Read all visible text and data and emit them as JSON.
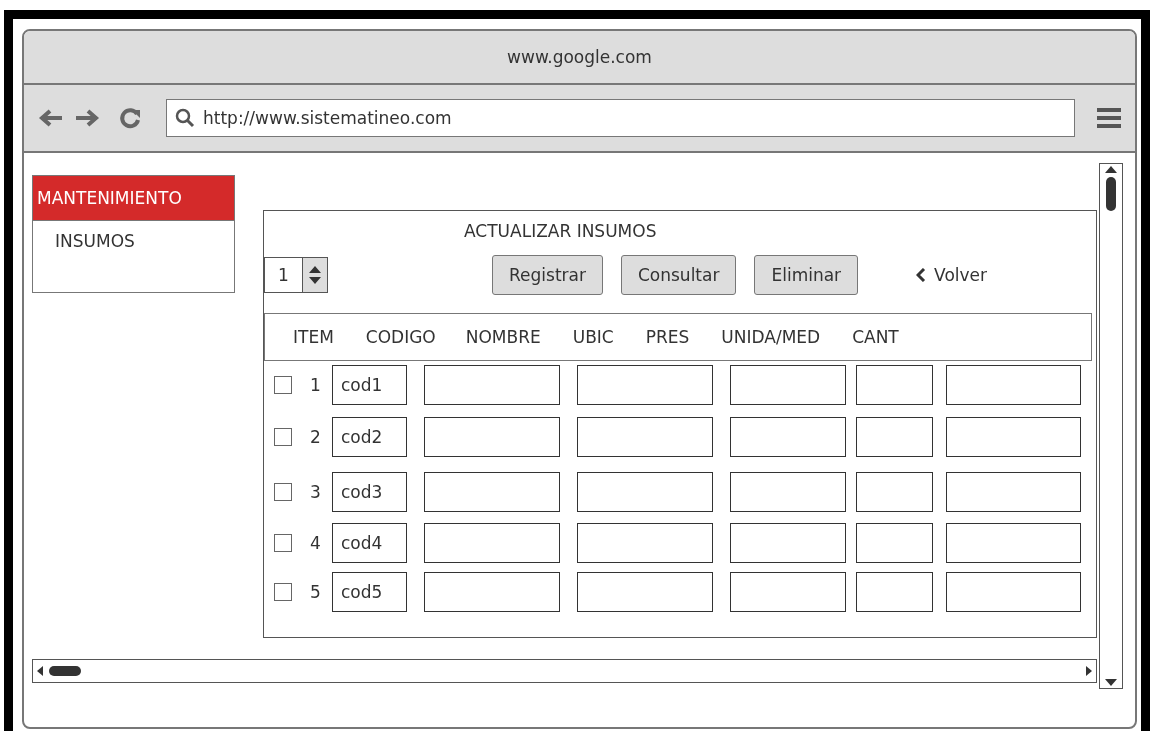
{
  "window": {
    "title": "www.google.com"
  },
  "toolbar": {
    "url": "http://www.sistematineo.com"
  },
  "sidebar": {
    "header": "MANTENIMIENTO",
    "items": [
      {
        "label": "INSUMOS",
        "selected": false
      }
    ]
  },
  "panel": {
    "title": "ACTUALIZAR INSUMOS",
    "spinner_value": "1",
    "buttons": [
      "Registrar",
      "Consultar",
      "Eliminar"
    ],
    "back_link": "Volver",
    "columns": [
      "ITEM",
      "CODIGO",
      "NOMBRE",
      "UBIC",
      "PRES",
      "UNIDA/MED",
      "CANT"
    ],
    "rows": [
      {
        "item": "1",
        "code": "cod1",
        "checked": false
      },
      {
        "item": "2",
        "code": "cod2",
        "checked": false
      },
      {
        "item": "3",
        "code": "cod3",
        "checked": false
      },
      {
        "item": "4",
        "code": "cod4",
        "checked": false
      },
      {
        "item": "5",
        "code": "cod5",
        "checked": false
      }
    ]
  }
}
